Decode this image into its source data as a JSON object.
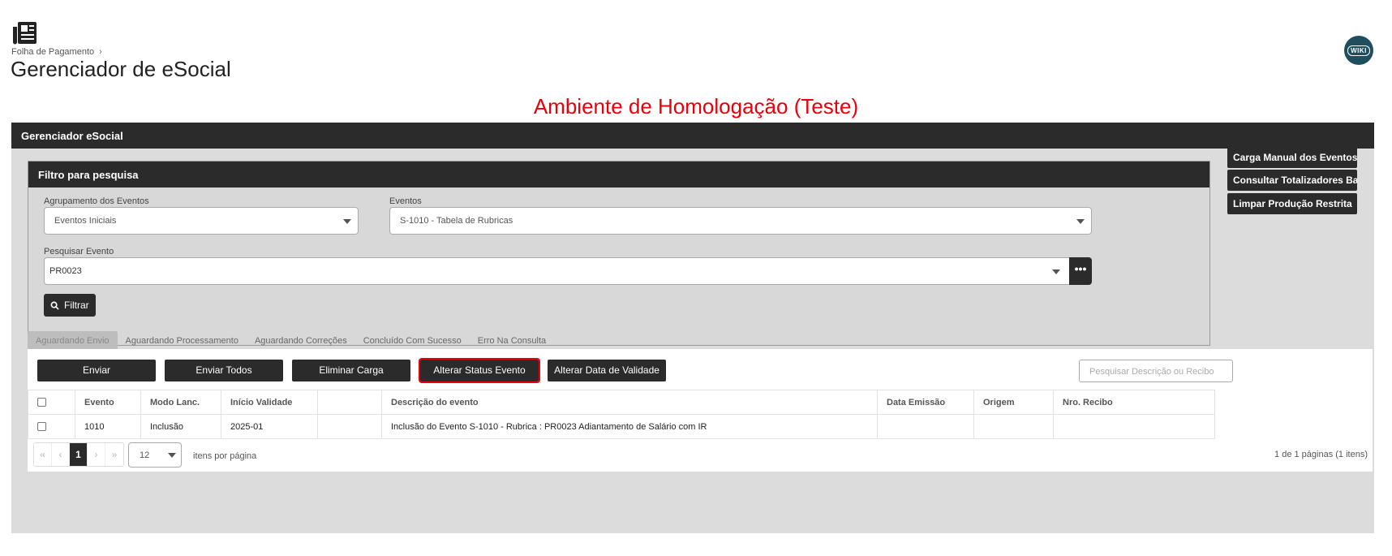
{
  "breadcrumb": {
    "parent": "Folha de Pagamento"
  },
  "page": {
    "title": "Gerenciador de eSocial"
  },
  "wiki": {
    "label": "WIKI"
  },
  "environment": {
    "banner": "Ambiente de Homologação (Teste)",
    "color": "#e8000b"
  },
  "panel": {
    "title": "Gerenciador eSocial"
  },
  "filter": {
    "title": "Filtro para pesquisa",
    "group_label": "Agrupamento dos Eventos",
    "group_value": "Eventos Iniciais",
    "events_label": "Eventos",
    "events_value": "S-1010 - Tabela de Rubricas",
    "search_label": "Pesquisar Evento",
    "search_value": "PR0023",
    "more_label": "•••",
    "filter_button": "Filtrar"
  },
  "side_buttons": [
    {
      "label": "Carga Manual dos Eventos"
    },
    {
      "label": "Consultar Totalizadores Base"
    },
    {
      "label": "Limpar Produção Restrita"
    }
  ],
  "tabs": [
    {
      "label": "Aguardando Envio"
    },
    {
      "label": "Aguardando Processamento"
    },
    {
      "label": "Aguardando Correções"
    },
    {
      "label": "Concluído Com Sucesso"
    },
    {
      "label": "Erro Na Consulta"
    }
  ],
  "actions": [
    {
      "label": "Enviar"
    },
    {
      "label": "Enviar Todos"
    },
    {
      "label": "Eliminar Carga"
    },
    {
      "label": "Alterar Status Evento"
    },
    {
      "label": "Alterar Data de Validade"
    }
  ],
  "desc_search": {
    "placeholder": "Pesquisar Descrição ou Recibo"
  },
  "table": {
    "columns": [
      "Evento",
      "Modo Lanc.",
      "Início Validade",
      "",
      "Descrição do evento",
      "Data Emissão",
      "Origem",
      "Nro. Recibo"
    ],
    "rows": [
      [
        "1010",
        "Inclusão",
        "2025-01",
        "",
        "Inclusão do Evento S-1010 - Rubrica : PR0023 Adiantamento de Salário com IR",
        "",
        "",
        ""
      ]
    ]
  },
  "pagination": {
    "first": "«",
    "prev": "‹",
    "current": "1",
    "next": "›",
    "last": "»",
    "per_page": "12",
    "per_page_label": "itens por página",
    "info": "1 de 1 páginas (1 itens)"
  }
}
